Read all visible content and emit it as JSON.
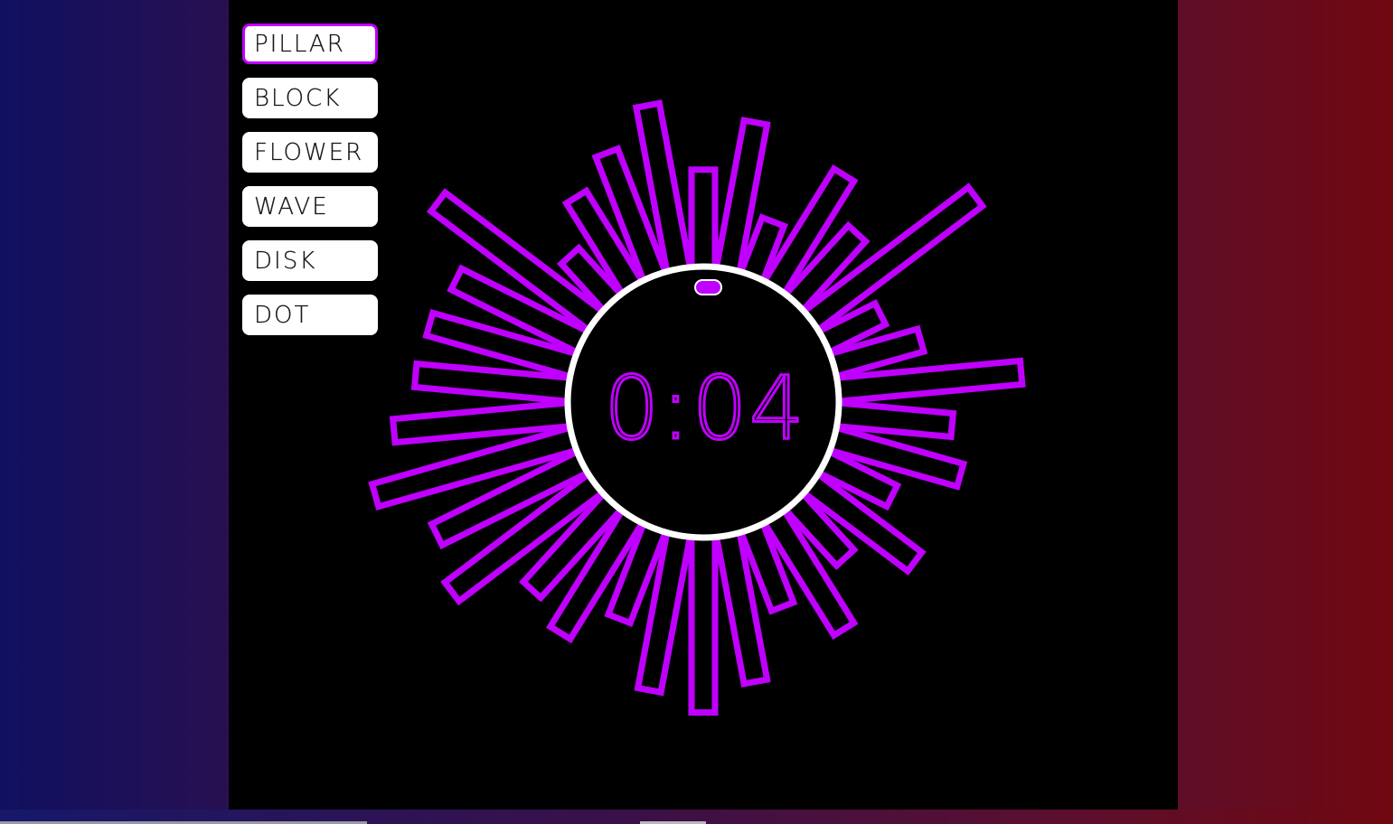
{
  "menu": {
    "items": [
      {
        "label": "PILLAR",
        "active": true
      },
      {
        "label": "BLOCK",
        "active": false
      },
      {
        "label": "FLOWER",
        "active": false
      },
      {
        "label": "WAVE",
        "active": false
      },
      {
        "label": "DISK",
        "active": false
      },
      {
        "label": "DOT",
        "active": false
      }
    ]
  },
  "player": {
    "time": "0:04",
    "accent_color": "#c000ff",
    "ring_color": "#ffffff",
    "bar_levels": [
      0.28,
      0.52,
      0.1,
      0.44,
      0.26,
      0.78,
      0.12,
      0.25,
      0.68,
      0.36,
      0.44,
      0.18,
      0.43,
      0.18,
      0.44,
      0.22,
      0.52,
      0.64,
      0.56,
      0.28,
      0.46,
      0.38,
      0.66,
      0.58,
      0.78,
      0.64,
      0.54,
      0.52,
      0.48,
      0.74,
      0.12,
      0.32,
      0.44,
      0.6
    ]
  },
  "background": {
    "left_color": "#101060",
    "right_color": "#700810"
  }
}
